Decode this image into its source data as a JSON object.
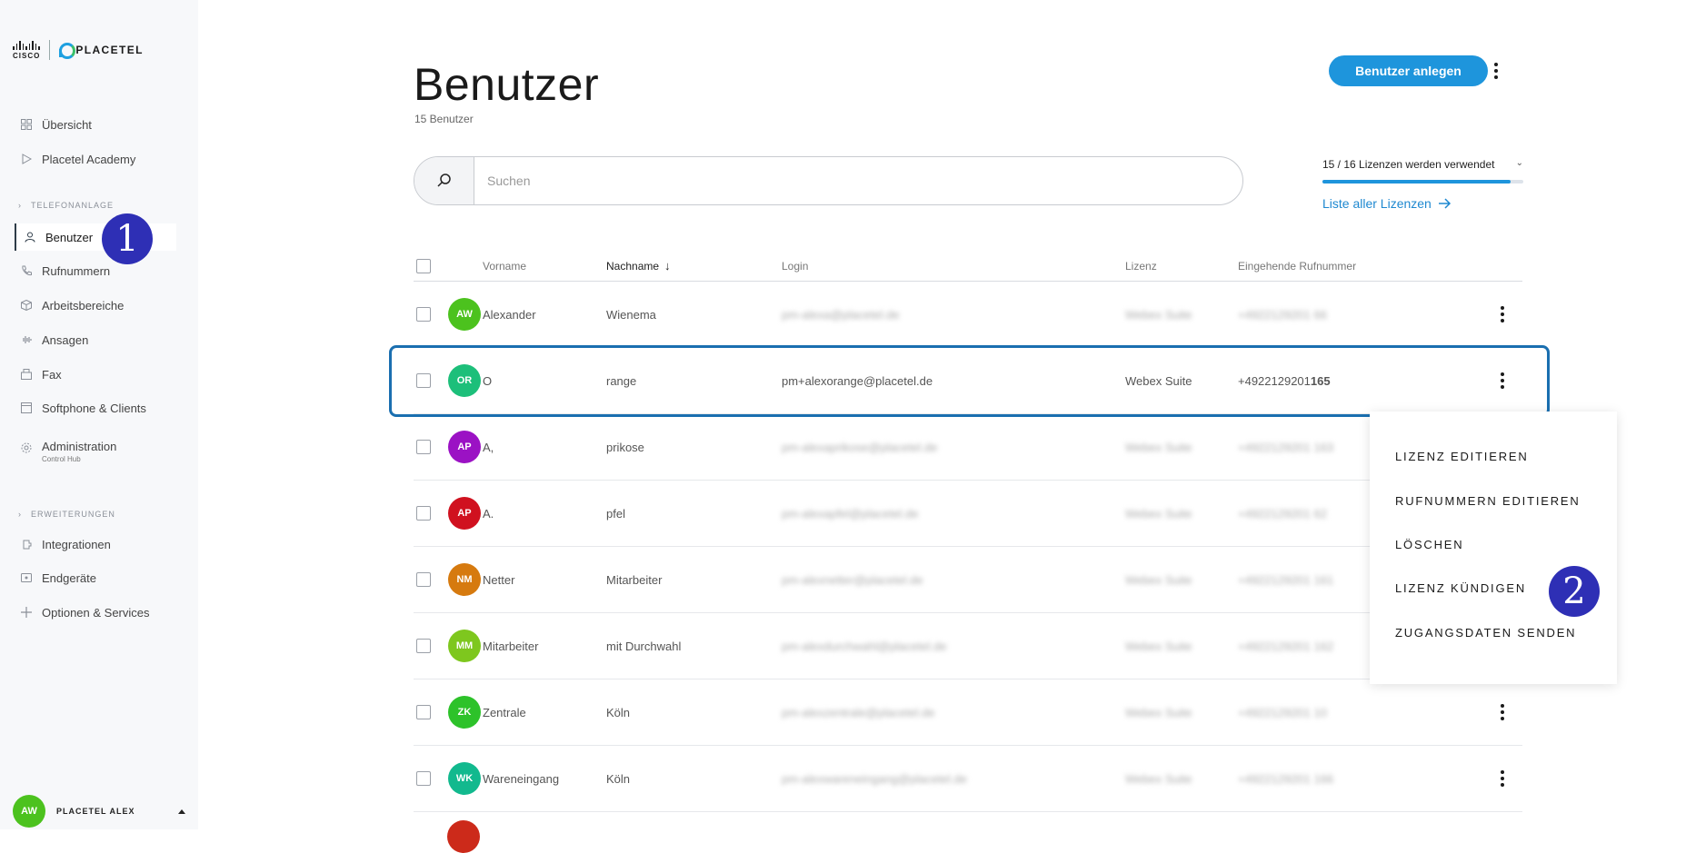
{
  "brand": {
    "cisco": "CISCO",
    "placetel": "PLACETEL"
  },
  "sidebar": {
    "items": [
      {
        "label": "Übersicht",
        "icon": "grid-icon"
      },
      {
        "label": "Placetel Academy",
        "icon": "play-icon"
      }
    ],
    "section_telefon": "TELEFONANLAGE",
    "telefon_items": [
      {
        "label": "Benutzer",
        "icon": "user-icon"
      },
      {
        "label": "Rufnummern",
        "icon": "phone-icon"
      },
      {
        "label": "Arbeitsbereiche",
        "icon": "box-icon"
      },
      {
        "label": "Ansagen",
        "icon": "audio-icon"
      },
      {
        "label": "Fax",
        "icon": "fax-icon"
      },
      {
        "label": "Softphone & Clients",
        "icon": "app-icon"
      },
      {
        "label": "Administration",
        "icon": "gear-icon",
        "sub": "Control Hub"
      }
    ],
    "section_ext": "ERWEITERUNGEN",
    "ext_items": [
      {
        "label": "Integrationen",
        "icon": "integration-icon"
      },
      {
        "label": "Endgeräte",
        "icon": "device-icon"
      },
      {
        "label": "Optionen & Services",
        "icon": "plus-icon"
      }
    ],
    "footer": {
      "initials": "AW",
      "name": "PLACETEL ALEX"
    }
  },
  "markers": {
    "one": "1",
    "two": "2"
  },
  "header": {
    "title": "Benutzer",
    "count": "15 Benutzer",
    "create_button": "Benutzer anlegen"
  },
  "search": {
    "placeholder": "Suchen"
  },
  "license": {
    "text": "15 / 16 Lizenzen werden verwendet",
    "used_fraction": 0.9375,
    "link": "Liste aller Lizenzen"
  },
  "table": {
    "headers": {
      "first": "Vorname",
      "last": "Nachname",
      "login": "Login",
      "license": "Lizenz",
      "number": "Eingehende Rufnummer"
    },
    "rows": [
      {
        "initials": "AW",
        "color": "#4cc21e",
        "first": "Alexander",
        "last": "Wienema",
        "login": "pm-alexa@placetel.de",
        "license": "Webex Suite",
        "number": "+4922129201 66",
        "blurred": true
      },
      {
        "initials": "OR",
        "color": "#1dbf7a",
        "first": "O",
        "last": "range",
        "login": "pm+alexorange@placetel.de",
        "license": "Webex Suite",
        "number_prefix": "+4922129201",
        "number_ext": "165",
        "blurred": false
      },
      {
        "initials": "AP",
        "color": "#9b12c4",
        "first": "A,",
        "last": "prikose",
        "login": "pm-alexaprikose@placetel.de",
        "license": "Webex Suite",
        "number": "+4922129201 163",
        "blurred": true
      },
      {
        "initials": "AP",
        "color": "#d0111f",
        "first": "A.",
        "last": "pfel",
        "login": "pm-alexapfel@placetel.de",
        "license": "Webex Suite",
        "number": "+4922129201 62",
        "blurred": true
      },
      {
        "initials": "NM",
        "color": "#d67a0f",
        "first": "Netter",
        "last": "Mitarbeiter",
        "login": "pm-alexnetter@placetel.de",
        "license": "Webex Suite",
        "number": "+4922129201 161",
        "blurred": true
      },
      {
        "initials": "MM",
        "color": "#7ec71e",
        "first": "Mitarbeiter",
        "last": "mit Durchwahl",
        "login": "pm-alexdurchwahl@placetel.de",
        "license": "Webex Suite",
        "number": "+4922129201 162",
        "blurred": true
      },
      {
        "initials": "ZK",
        "color": "#2dc22a",
        "first": "Zentrale",
        "last": "Köln",
        "login": "pm-alexzentrale@placetel.de",
        "license": "Webex Suite",
        "number": "+4922129201 10",
        "blurred": true
      },
      {
        "initials": "WK",
        "color": "#12b98e",
        "first": "Wareneingang",
        "last": "Köln",
        "login": "pm-alexwareneingang@placetel.de",
        "license": "Webex Suite",
        "number": "+4922129201 166",
        "blurred": true
      }
    ]
  },
  "context_menu": [
    "LIZENZ EDITIEREN",
    "RUFNUMMERN EDITIEREN",
    "LÖSCHEN",
    "LIZENZ KÜNDIGEN",
    "ZUGANGSDATEN SENDEN"
  ]
}
